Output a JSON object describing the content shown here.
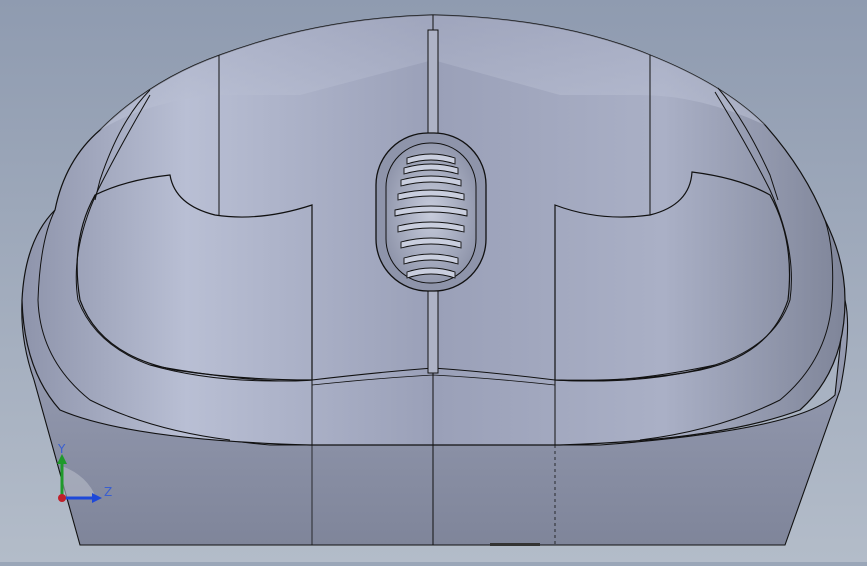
{
  "colors": {
    "background_top": "#8f9bb0",
    "background_bottom": "#b3bcc9",
    "body_light": "#b9bfd3",
    "body_mid": "#99a0b8",
    "body_dark": "#7d8399",
    "edge": "#111111",
    "axis_x": "#c0202a",
    "axis_y": "#1f9a2b",
    "axis_z": "#1e48d8"
  },
  "icons": {
    "wheel": "scroll-wheel-icon",
    "triad": "coordinate-triad-icon"
  },
  "triad": {
    "y_label": "Y",
    "z_label": "Z"
  }
}
